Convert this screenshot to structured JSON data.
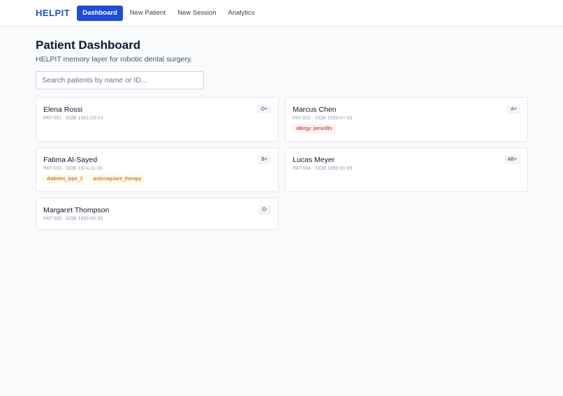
{
  "nav": {
    "brand": "HELPIT",
    "links": [
      {
        "label": "Dashboard"
      },
      {
        "label": "New Patient"
      },
      {
        "label": "New Session"
      },
      {
        "label": "Analytics"
      }
    ]
  },
  "header": {
    "title": "Patient Dashboard",
    "subtitle": "HELPIT memory layer for robotic dental surgery."
  },
  "search": {
    "placeholder": "Search patients by name or ID...",
    "value": ""
  },
  "patients": [
    {
      "name": "Elena Rossi",
      "meta": "PAT-001 · DOB 1981-03-14",
      "blood": "O+",
      "tags": []
    },
    {
      "name": "Marcus Chen",
      "meta": "PAT-002 · DOB 1959-07-02",
      "blood": "A+",
      "tags": [
        {
          "label": "allergy: penicillin",
          "kind": "danger"
        }
      ]
    },
    {
      "name": "Fatima Al-Sayed",
      "meta": "PAT-003 · DOB 1974-11-20",
      "blood": "B+",
      "tags": [
        {
          "label": "diabetes_type_2",
          "kind": "warning"
        },
        {
          "label": "anticoagulant_therapy",
          "kind": "warning"
        }
      ]
    },
    {
      "name": "Lucas Meyer",
      "meta": "PAT-004 · DOB 1988-01-09",
      "blood": "AB+",
      "tags": []
    },
    {
      "name": "Margaret Thompson",
      "meta": "PAT-005 · DOB 1955-05-30",
      "blood": "O-",
      "tags": []
    }
  ],
  "colors": {
    "accent": "#1d4ed8",
    "danger_text": "#b91c1c",
    "warning_text": "#b45309"
  }
}
